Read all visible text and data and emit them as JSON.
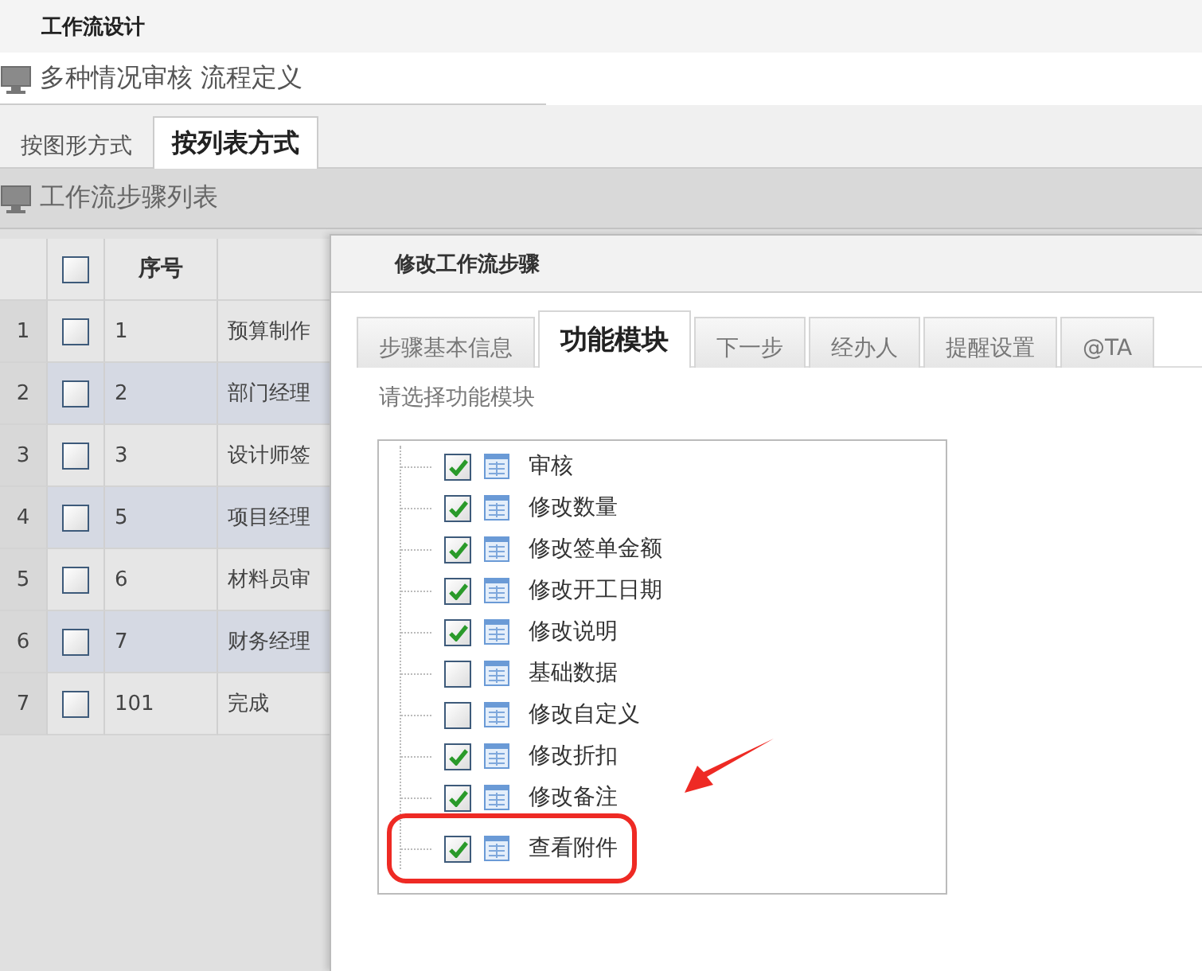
{
  "app_title": "工作流设计",
  "breadcrumb": "多种情况审核 流程定义",
  "view_tabs": [
    {
      "label": "按图形方式",
      "selected": false
    },
    {
      "label": "按列表方式",
      "selected": true
    }
  ],
  "list_title": "工作流步骤列表",
  "table": {
    "header_checkbox": {
      "checked": false
    },
    "columns": [
      "序号"
    ],
    "rows": [
      {
        "row_number": "1",
        "checked": false,
        "seq": "1",
        "column_4": "预算制作"
      },
      {
        "row_number": "2",
        "checked": false,
        "seq": "2",
        "column_4": "部门经理"
      },
      {
        "row_number": "3",
        "checked": false,
        "seq": "3",
        "column_4": "设计师签"
      },
      {
        "row_number": "4",
        "checked": false,
        "seq": "5",
        "column_4": "项目经理"
      },
      {
        "row_number": "5",
        "checked": false,
        "seq": "6",
        "column_4": "材料员审"
      },
      {
        "row_number": "6",
        "checked": false,
        "seq": "7",
        "column_4": "财务经理"
      },
      {
        "row_number": "7",
        "checked": false,
        "seq": "101",
        "column_4": "完成"
      }
    ]
  },
  "dialog": {
    "title": "修改工作流步骤",
    "tabs": [
      {
        "label": "步骤基本信息",
        "selected": false
      },
      {
        "label": "功能模块",
        "selected": true
      },
      {
        "label": "下一步",
        "selected": false
      },
      {
        "label": "经办人",
        "selected": false
      },
      {
        "label": "提醒设置",
        "selected": false
      },
      {
        "label": "@TA",
        "selected": false
      }
    ],
    "prompt": "请选择功能模块",
    "modules": [
      {
        "label": "审核",
        "checked": true,
        "highlighted": false
      },
      {
        "label": "修改数量",
        "checked": true,
        "highlighted": false
      },
      {
        "label": "修改签单金额",
        "checked": true,
        "highlighted": false
      },
      {
        "label": "修改开工日期",
        "checked": true,
        "highlighted": false
      },
      {
        "label": "修改说明",
        "checked": true,
        "highlighted": false
      },
      {
        "label": "基础数据",
        "checked": false,
        "highlighted": false
      },
      {
        "label": "修改自定义",
        "checked": false,
        "highlighted": false
      },
      {
        "label": "修改折扣",
        "checked": true,
        "highlighted": false
      },
      {
        "label": "修改备注",
        "checked": true,
        "highlighted": false
      },
      {
        "label": "查看附件",
        "checked": true,
        "highlighted": true
      }
    ]
  }
}
